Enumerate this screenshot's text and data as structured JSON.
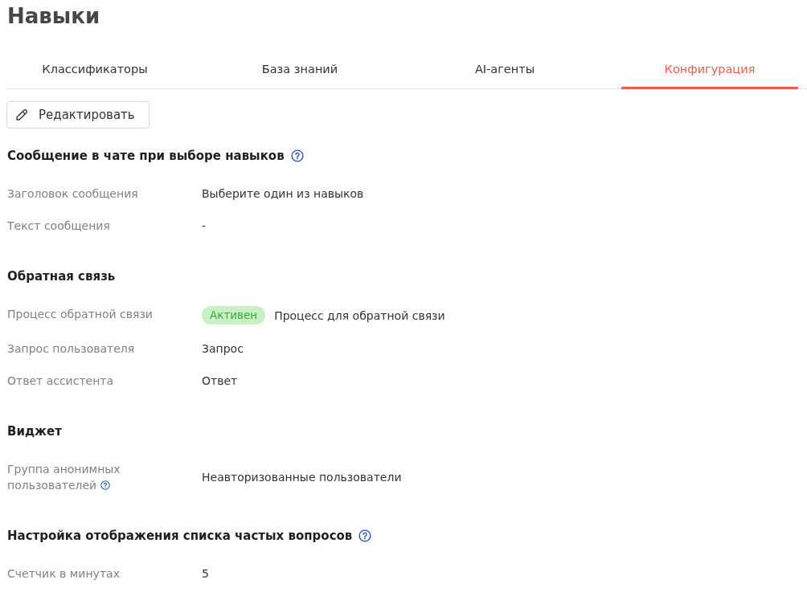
{
  "page": {
    "title": "Навыки"
  },
  "tabs": [
    {
      "label": "Классификаторы",
      "selected": false
    },
    {
      "label": "База знаний",
      "selected": false
    },
    {
      "label": "AI-агенты",
      "selected": false
    },
    {
      "label": "Конфигурация",
      "selected": true
    }
  ],
  "toolbar": {
    "edit_button": {
      "label": "Редактировать"
    }
  },
  "sections": [
    {
      "title": "Сообщение в чате при выборе навыков",
      "help": true,
      "fields": [
        {
          "label": "Заголовок сообщения",
          "help": false,
          "value": "Выберите один из навыков"
        },
        {
          "label": "Текст сообщения",
          "help": false,
          "value": "-"
        }
      ]
    },
    {
      "title": "Обратная связь",
      "help": false,
      "fields": [
        {
          "label": "Процесс обратной связи",
          "help": false,
          "badge": "Активен",
          "value": "Процесс для обратной связи"
        },
        {
          "label": "Запрос пользователя",
          "help": false,
          "value": "Запрос"
        },
        {
          "label": "Ответ ассистента",
          "help": false,
          "value": "Ответ"
        }
      ]
    },
    {
      "title": "Виджет",
      "help": false,
      "fields": [
        {
          "label": "Группа анонимных пользователей",
          "help": true,
          "value": "Неавторизованные пользователи"
        }
      ]
    },
    {
      "title": "Настройка отображения списка частых вопросов",
      "help": true,
      "fields": [
        {
          "label": "Счетчик в минутах",
          "help": false,
          "value": "5"
        }
      ]
    }
  ]
}
